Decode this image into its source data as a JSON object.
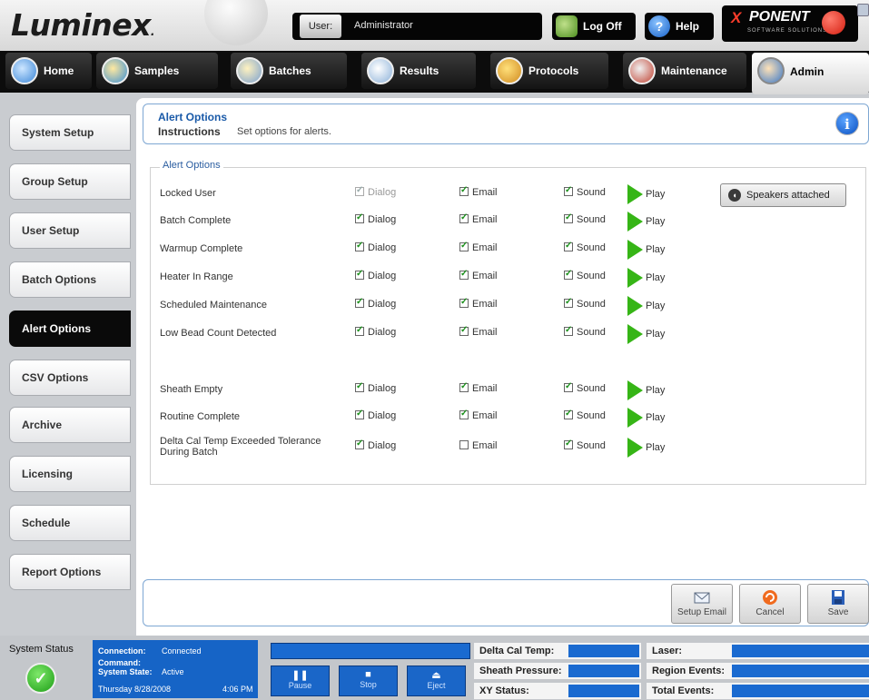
{
  "header": {
    "logo": "Luminex",
    "user_label": "User:",
    "user_value": "Administrator",
    "logoff_label": "Log Off",
    "help_label": "Help",
    "brand_name": "PONENT",
    "brand_x": "X",
    "brand_sub": "SOFTWARE SOLUTIONS"
  },
  "nav": {
    "tabs": [
      {
        "label": "Home"
      },
      {
        "label": "Samples"
      },
      {
        "label": "Batches"
      },
      {
        "label": "Results"
      },
      {
        "label": "Protocols"
      },
      {
        "label": "Maintenance"
      },
      {
        "label": "Admin"
      }
    ],
    "active": "Admin"
  },
  "sidebar": {
    "items": [
      {
        "label": "System Setup"
      },
      {
        "label": "Group Setup"
      },
      {
        "label": "User Setup"
      },
      {
        "label": "Batch Options"
      },
      {
        "label": "Alert Options"
      },
      {
        "label": "CSV Options"
      },
      {
        "label": "Archive"
      },
      {
        "label": "Licensing"
      },
      {
        "label": "Schedule"
      },
      {
        "label": "Report Options"
      }
    ],
    "active": "Alert Options"
  },
  "main": {
    "title": "Alert Options",
    "instructions_label": "Instructions",
    "instructions_text": "Set options for alerts.",
    "group_label": "Alert Options",
    "col_dialog": "Dialog",
    "col_email": "Email",
    "col_sound": "Sound",
    "play_label": "Play",
    "speakers_label": "Speakers attached",
    "alerts": [
      {
        "name": "Locked User",
        "dialog": true,
        "dialog_disabled": true,
        "email": true,
        "sound": true
      },
      {
        "name": "Batch Complete",
        "dialog": true,
        "email": true,
        "sound": true
      },
      {
        "name": "Warmup Complete",
        "dialog": true,
        "email": true,
        "sound": true
      },
      {
        "name": "Heater In Range",
        "dialog": true,
        "email": true,
        "sound": true
      },
      {
        "name": "Scheduled Maintenance",
        "dialog": true,
        "email": true,
        "sound": true
      },
      {
        "name": "Low Bead Count Detected",
        "dialog": true,
        "email": true,
        "sound": true
      },
      {
        "name": "Sheath Empty",
        "dialog": true,
        "email": true,
        "sound": true
      },
      {
        "name": "Routine Complete",
        "dialog": true,
        "email": true,
        "sound": true
      },
      {
        "name": "Delta Cal Temp Exceeded Tolerance During Batch",
        "dialog": true,
        "email": false,
        "sound": true
      }
    ],
    "buttons": {
      "setup_email": "Setup Email",
      "cancel": "Cancel",
      "save": "Save"
    }
  },
  "status": {
    "system_status_label": "System Status",
    "connection_label": "Connection:",
    "connection_value": "Connected",
    "command_label": "Command:",
    "command_value": "",
    "system_state_label": "System State:",
    "system_state_value": "Active",
    "date": "Thursday 8/28/2008",
    "time": "4:06 PM",
    "pause": "Pause",
    "stop": "Stop",
    "eject": "Eject",
    "delta_cal_temp": "Delta Cal Temp:",
    "sheath_pressure": "Sheath Pressure:",
    "xy_status": "XY Status:",
    "laser": "Laser:",
    "region_events": "Region Events:",
    "total_events": "Total Events:"
  },
  "colors": {
    "accent_blue": "#1a5aa8",
    "status_blue": "#1664c6",
    "play_green": "#36b516",
    "ok_green": "#1c9d16"
  }
}
